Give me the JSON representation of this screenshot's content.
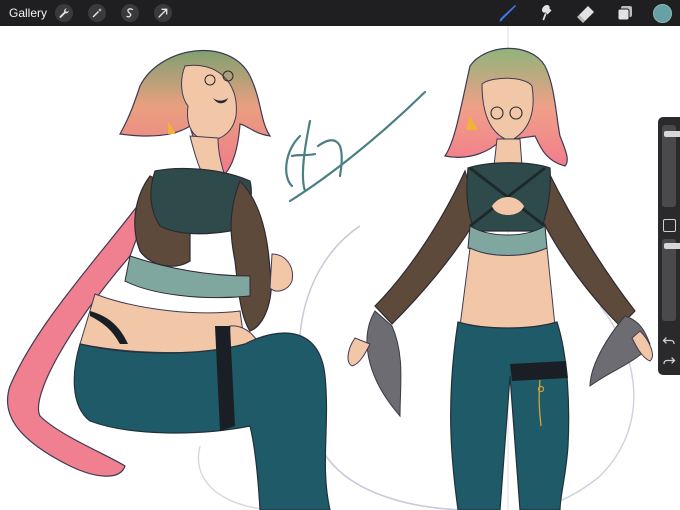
{
  "toolbar": {
    "gallery_label": "Gallery",
    "left_tools": [
      "wrench-icon",
      "magic-wand-icon",
      "selection-icon",
      "transform-arrow-icon"
    ],
    "right_tools": [
      "brush-icon",
      "smudge-icon",
      "eraser-icon",
      "layers-icon"
    ],
    "active_tool": "brush-icon",
    "active_color": "#67a1a3",
    "accent_color": "#3d7cf5"
  },
  "canvas": {
    "signature_text": "Ethirea"
  },
  "sidebar": {
    "brush_size": 0.92,
    "brush_opacity": 0.95,
    "tools": [
      "modifier-button-icon",
      "undo-icon",
      "redo-icon"
    ]
  }
}
